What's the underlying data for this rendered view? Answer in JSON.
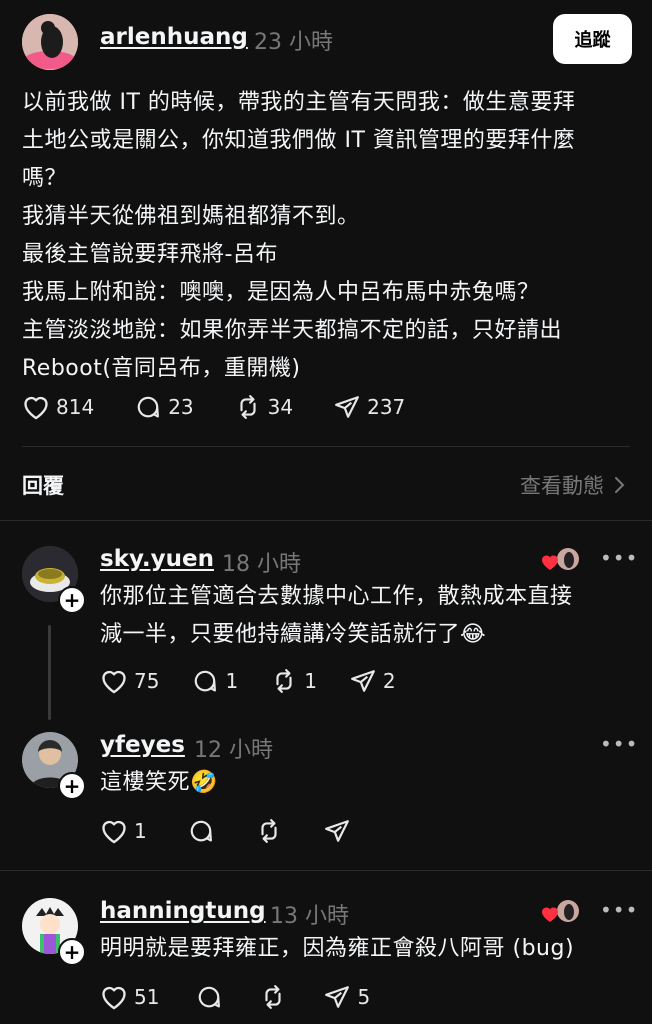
{
  "top_partial": "",
  "post": {
    "username": "arlenhuang",
    "time": "23 小時",
    "follow_label": "追蹤",
    "lines": [
      "以前我做 IT 的時候，帶我的主管有天問我：做生意要拜",
      "土地公或是關公，你知道我們做 IT 資訊管理的要拜什麼",
      "嗎？",
      "我猜半天從佛祖到媽祖都猜不到。",
      "最後主管說要拜飛將-呂布",
      "我馬上附和說：噢噢，是因為人中呂布馬中赤兔嗎？",
      "主管淡淡地說：如果你弄半天都搞不定的話，只好請出",
      "Reboot(音同呂布，重開機)"
    ],
    "likes": "814",
    "comments": "23",
    "reposts": "34",
    "shares": "237"
  },
  "replies_header": {
    "title": "回覆",
    "activity": "查看動態"
  },
  "replies": [
    {
      "username": "sky.yuen",
      "time": "18 小時",
      "lines": [
        "你那位主管適合去數據中心工作，散熱成本直接",
        "減一半，只要他持續講冷笑話就行了😂"
      ],
      "likes": "75",
      "comments": "1",
      "reposts": "1",
      "shares": "2"
    },
    {
      "username": "yfeyes",
      "time": "12 小時",
      "lines": [
        "這樓笑死🤣"
      ],
      "likes": "1",
      "comments": "",
      "reposts": "",
      "shares": ""
    },
    {
      "username": "hanningtung",
      "time": "13 小時",
      "lines": [
        "明明就是要拜雍正，因為雍正會殺八阿哥 (bug)"
      ],
      "likes": "51",
      "comments": "",
      "reposts": "",
      "shares": "5"
    }
  ],
  "icons": {
    "heart": "heart-icon",
    "comment": "comment-icon",
    "repost": "repost-icon",
    "share": "share-icon",
    "more": "more-icon",
    "plus": "plus-icon",
    "chevron": "chevron-right-icon"
  },
  "colors": {
    "background": "#101010",
    "text": "#f3f5f7",
    "muted": "#777777",
    "heart": "#ff3040"
  }
}
